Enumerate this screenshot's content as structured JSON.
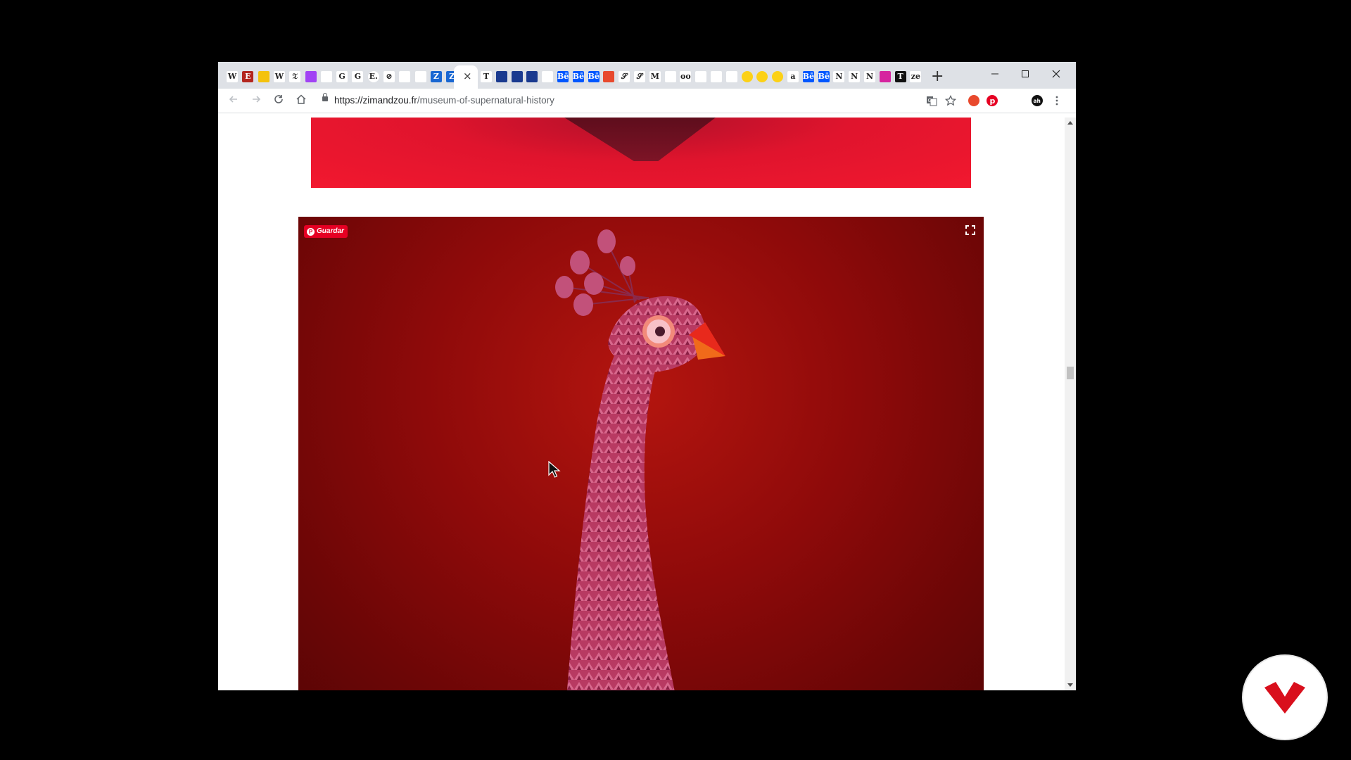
{
  "browser": {
    "tabs": [
      {
        "icon": "wikipedia-icon",
        "glyph": "W",
        "color": "#ffffff"
      },
      {
        "icon": "e-red-icon",
        "glyph": "E",
        "color": "#b3261e"
      },
      {
        "icon": "yellow-box-icon",
        "glyph": "",
        "color": "#f4c20d"
      },
      {
        "icon": "wikipedia-icon",
        "glyph": "W",
        "color": "#ffffff"
      },
      {
        "icon": "nyt-icon",
        "glyph": "𝔗",
        "color": "#ffffff"
      },
      {
        "icon": "purple-icon",
        "glyph": "",
        "color": "#a142f4"
      },
      {
        "icon": "doc-icon",
        "glyph": "",
        "color": "#ffffff"
      },
      {
        "icon": "google-icon",
        "glyph": "G",
        "color": "#ffffff"
      },
      {
        "icon": "google-icon",
        "glyph": "G",
        "color": "#ffffff"
      },
      {
        "icon": "e-dot-icon",
        "glyph": "E.",
        "color": "#ffffff"
      },
      {
        "icon": "circle-slash-icon",
        "glyph": "⊘",
        "color": "#ffffff"
      },
      {
        "icon": "doc-icon",
        "glyph": "",
        "color": "#ffffff"
      },
      {
        "icon": "doc-icon",
        "glyph": "",
        "color": "#ffffff"
      },
      {
        "icon": "z-blue-icon",
        "glyph": "Z",
        "color": "#1967d2"
      },
      {
        "icon": "z-blue-icon",
        "glyph": "Z",
        "color": "#1967d2"
      }
    ],
    "tabs_right": [
      {
        "icon": "t-bold-icon",
        "glyph": "T",
        "color": "#ffffff"
      },
      {
        "icon": "blue-square-icon",
        "glyph": "",
        "color": "#1a3a8f"
      },
      {
        "icon": "blue-square-icon",
        "glyph": "",
        "color": "#1a3a8f"
      },
      {
        "icon": "blue-square-icon",
        "glyph": "",
        "color": "#1a3a8f"
      },
      {
        "icon": "white-square-icon",
        "glyph": "",
        "color": "#ffffff"
      },
      {
        "icon": "behance-icon",
        "glyph": "Bē",
        "color": "#0057ff"
      },
      {
        "icon": "behance-icon",
        "glyph": "Bē",
        "color": "#0057ff"
      },
      {
        "icon": "behance-icon",
        "glyph": "Bē",
        "color": "#0057ff"
      },
      {
        "icon": "lips-icon",
        "glyph": "",
        "color": "#e8492d"
      },
      {
        "icon": "script-icon",
        "glyph": "𝒮",
        "color": "#ffffff"
      },
      {
        "icon": "script-icon",
        "glyph": "𝒮",
        "color": "#ffffff"
      },
      {
        "icon": "m-icon",
        "glyph": "M",
        "color": "#ffffff"
      },
      {
        "icon": "doc-icon",
        "glyph": "",
        "color": "#ffffff"
      },
      {
        "icon": "glasses-icon",
        "glyph": "oo",
        "color": "#ffffff"
      },
      {
        "icon": "doc-icon",
        "glyph": "",
        "color": "#ffffff"
      },
      {
        "icon": "doc-icon",
        "glyph": "",
        "color": "#ffffff"
      },
      {
        "icon": "doc-icon",
        "glyph": "",
        "color": "#ffffff"
      },
      {
        "icon": "yellow-dot-icon",
        "glyph": "",
        "color": "#fcd116"
      },
      {
        "icon": "yellow-dot-icon",
        "glyph": "",
        "color": "#fcd116"
      },
      {
        "icon": "yellow-dot-icon",
        "glyph": "",
        "color": "#fcd116"
      },
      {
        "icon": "a-bold-icon",
        "glyph": "a",
        "color": "#ffffff"
      },
      {
        "icon": "behance-icon",
        "glyph": "Bē",
        "color": "#0057ff"
      },
      {
        "icon": "behance-icon",
        "glyph": "Bē",
        "color": "#0057ff"
      },
      {
        "icon": "n-icon",
        "glyph": "N",
        "color": "#ffffff"
      },
      {
        "icon": "n-icon",
        "glyph": "N",
        "color": "#ffffff"
      },
      {
        "icon": "n-icon",
        "glyph": "N",
        "color": "#ffffff"
      },
      {
        "icon": "instagram-icon",
        "glyph": "",
        "color": "#d6249f"
      },
      {
        "icon": "t-black-icon",
        "glyph": "T",
        "color": "#111111"
      },
      {
        "icon": "zeen-icon",
        "glyph": "ze",
        "color": "#ffffff"
      }
    ],
    "close_tab_glyph": "×",
    "new_tab_glyph": "+",
    "url_host": "https://zimandzou.fr",
    "url_path": "/museum-of-supernatural-history"
  },
  "page": {
    "pin_button_label": "Guardar",
    "pin_color": "#e60023"
  }
}
